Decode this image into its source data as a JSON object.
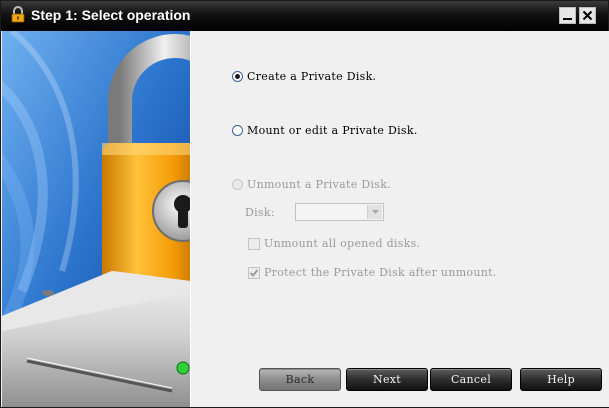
{
  "window": {
    "title": "Step 1: Select operation",
    "icons": {
      "app": "private-disk-lock-icon",
      "minimize": "minimize-icon",
      "close": "close-icon"
    }
  },
  "side_image": {
    "icon": "padlock-on-hard-drive-illustration"
  },
  "options": {
    "create": {
      "label": "Create a Private Disk.",
      "selected": true
    },
    "mount": {
      "label": "Mount or edit a Private Disk.",
      "selected": false
    },
    "unmount": {
      "label": "Unmount a Private Disk.",
      "selected": false,
      "disabled": true
    }
  },
  "unmount_settings": {
    "disk_label": "Disk:",
    "disk_value": "",
    "unmount_all": {
      "label": "Unmount all opened disks.",
      "checked": false,
      "disabled": true
    },
    "protect": {
      "label": "Protect the Private Disk after unmount.",
      "checked": true,
      "disabled": true
    }
  },
  "buttons": {
    "back": "Back",
    "next": "Next",
    "cancel": "Cancel",
    "help": "Help"
  },
  "colors": {
    "titlebar": "#000000",
    "accent_blue": "#2c6fc4",
    "lock_gold": "#f3a20a"
  }
}
